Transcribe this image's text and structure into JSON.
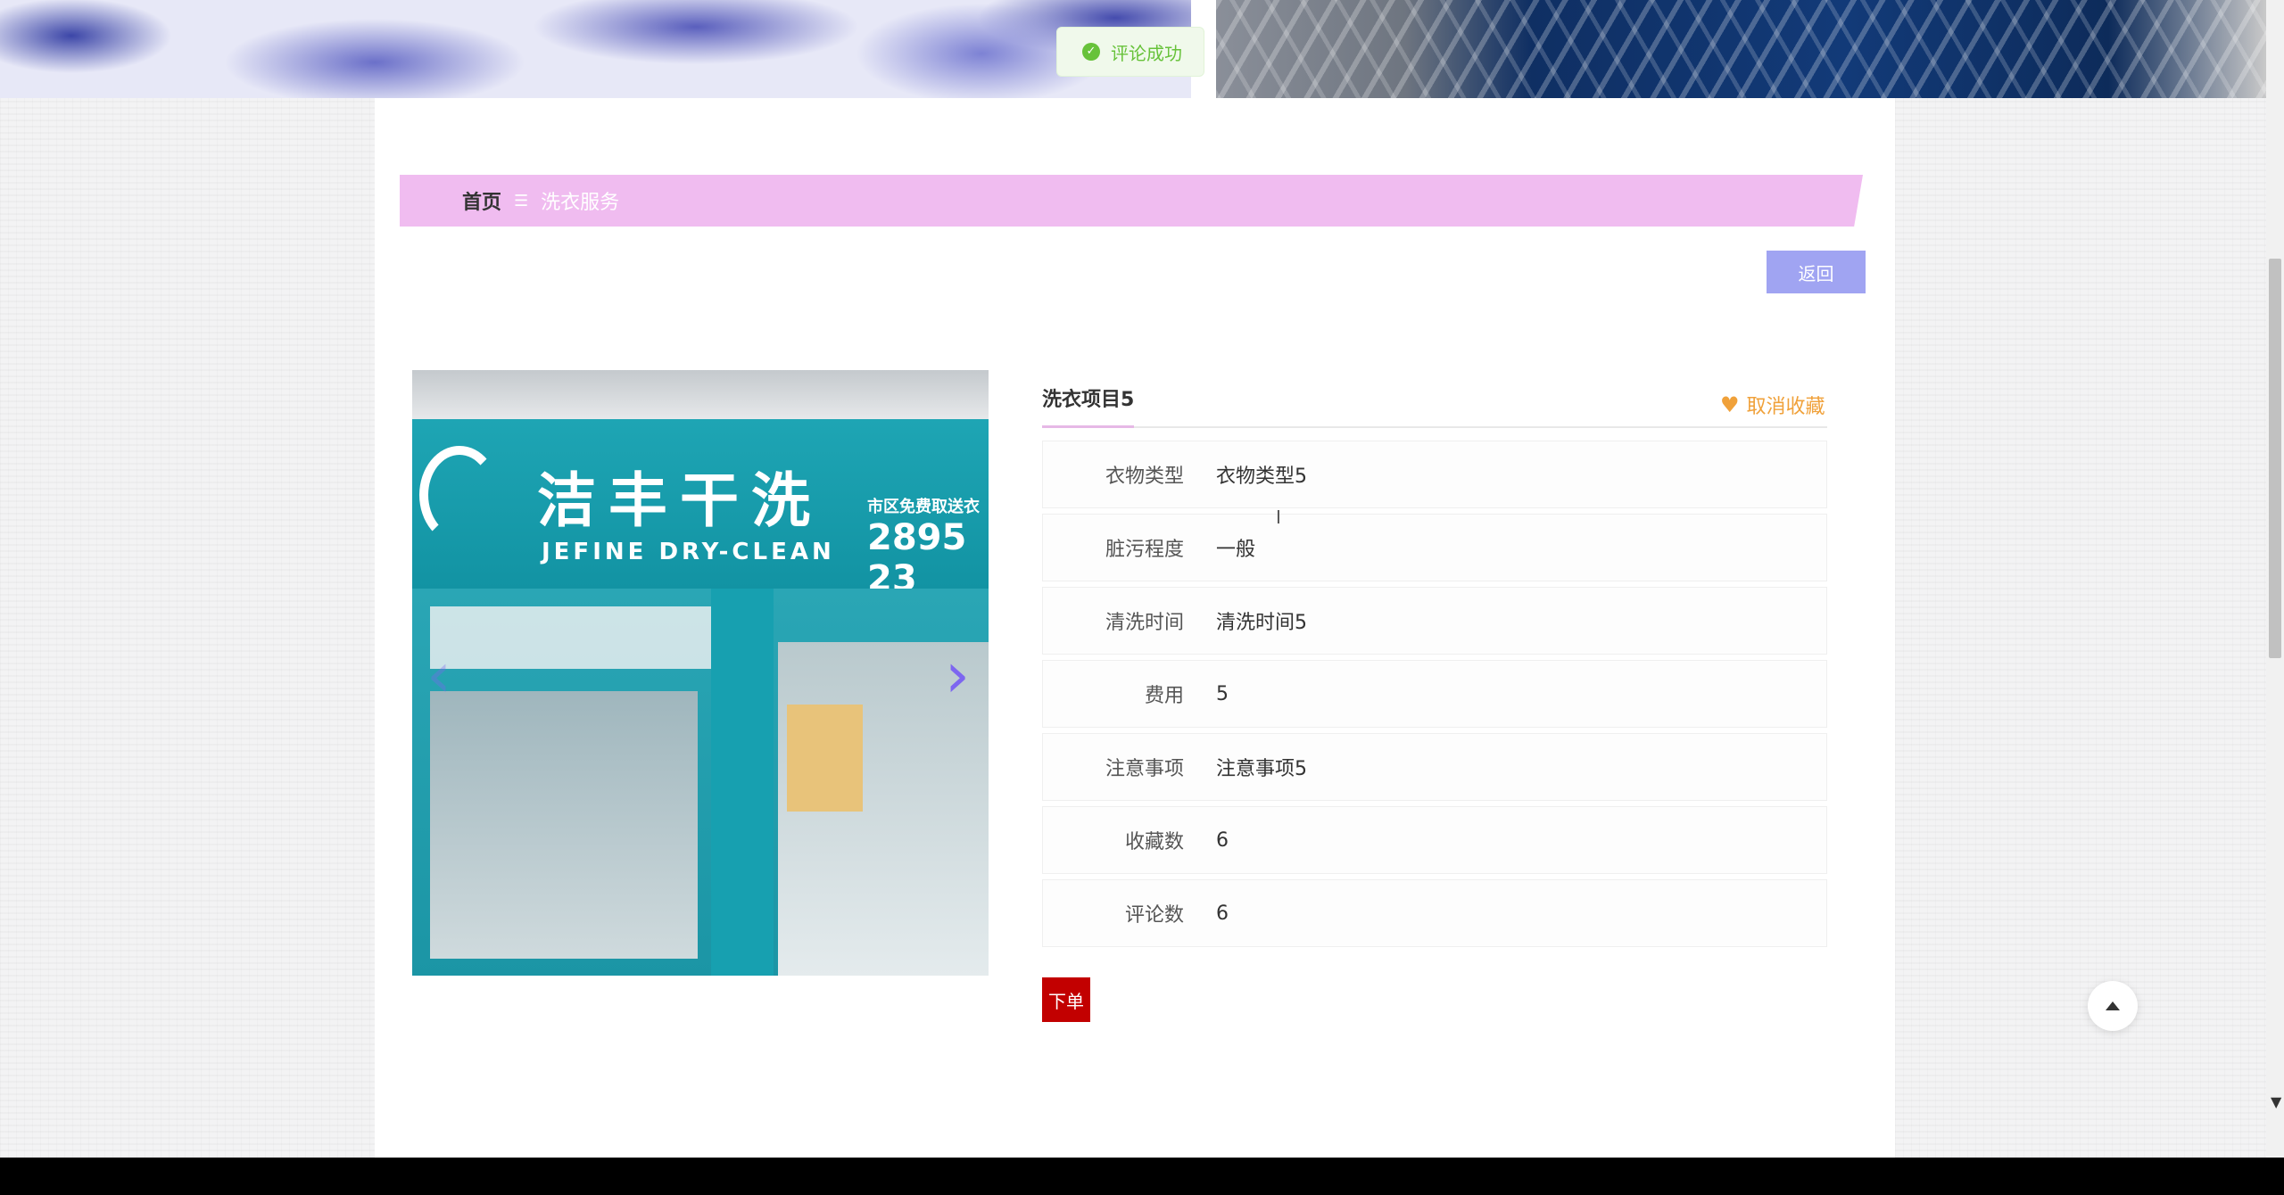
{
  "toast": {
    "message": "评论成功"
  },
  "breadcrumb": {
    "home": "首页",
    "separator": "☰",
    "current": "洗衣服务"
  },
  "back_button": {
    "label": "返回"
  },
  "store_image": {
    "sign_cn": "洁丰干洗",
    "sign_en": "JEFINE DRY-CLEAN",
    "sign_phone": "2895 23",
    "sign_small": "市区免费取送衣"
  },
  "detail": {
    "title": "洗衣项目5",
    "favorite_label": "取消收藏",
    "rows": [
      {
        "label": "衣物类型",
        "value": "衣物类型5"
      },
      {
        "label": "脏污程度",
        "value": "一般"
      },
      {
        "label": "清洗时间",
        "value": "清洗时间5"
      },
      {
        "label": "费用",
        "value": "5"
      },
      {
        "label": "注意事项",
        "value": "注意事项5"
      },
      {
        "label": "收藏数",
        "value": "6"
      },
      {
        "label": "评论数",
        "value": "6"
      }
    ],
    "order_label": "下单"
  },
  "colors": {
    "breadcrumb_bg": "#f0bcf0",
    "back_button_bg": "#a0a4f2",
    "order_button_bg": "#c20000",
    "favorite_color": "#f0a13a",
    "toast_color": "#67c23a"
  },
  "icons": {
    "toast": "check-circle-icon",
    "favorite": "heart-icon",
    "carousel_prev": "chevron-left-icon",
    "carousel_next": "chevron-right-icon",
    "back_to_top": "arrow-up-icon"
  }
}
